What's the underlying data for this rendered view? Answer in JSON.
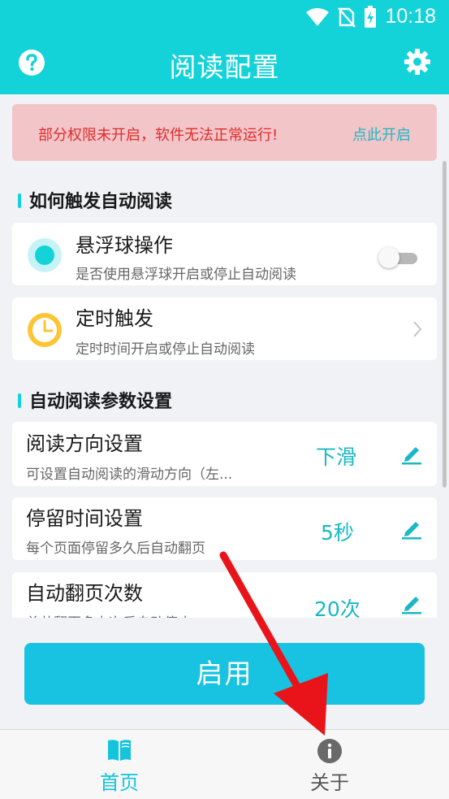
{
  "status_bar": {
    "time": "10:18",
    "icons": [
      "wifi-icon",
      "no-sim-icon",
      "battery-charging-icon"
    ]
  },
  "app_bar": {
    "title": "阅读配置",
    "left_icon": "help-icon",
    "right_icon": "gear-icon"
  },
  "warning": {
    "message": "部分权限未开启，软件无法正常运行!",
    "action": "点此开启"
  },
  "sections": {
    "trigger": "如何触发自动阅读",
    "params": "自动阅读参数设置"
  },
  "trigger_items": [
    {
      "title": "悬浮球操作",
      "subtitle": "是否使用悬浮球开启或停止自动阅读",
      "icon": "float-ball-icon",
      "toggle_on": false
    },
    {
      "title": "定时触发",
      "subtitle": "定时时间开启或停止自动阅读",
      "icon": "clock-icon"
    }
  ],
  "param_items": [
    {
      "title": "阅读方向设置",
      "subtitle": "可设置自动阅读的滑动方向（左...",
      "value": "下滑"
    },
    {
      "title": "停留时间设置",
      "subtitle": "每个页面停留多久后自动翻页",
      "value": "5秒"
    },
    {
      "title": "自动翻页次数",
      "subtitle": "总共翻页多少次后自动停止",
      "value": "20次"
    }
  ],
  "primary_button": "启用",
  "tabs": [
    {
      "label": "首页",
      "icon": "book-icon",
      "active": true
    },
    {
      "label": "关于",
      "icon": "info-icon",
      "active": false
    }
  ],
  "colors": {
    "accent": "#14d3d8",
    "warning_bg": "#f2c5c8",
    "warning_text": "#e12b2b",
    "value_text": "#19b8c4",
    "annotation_arrow": "#e8141a"
  }
}
